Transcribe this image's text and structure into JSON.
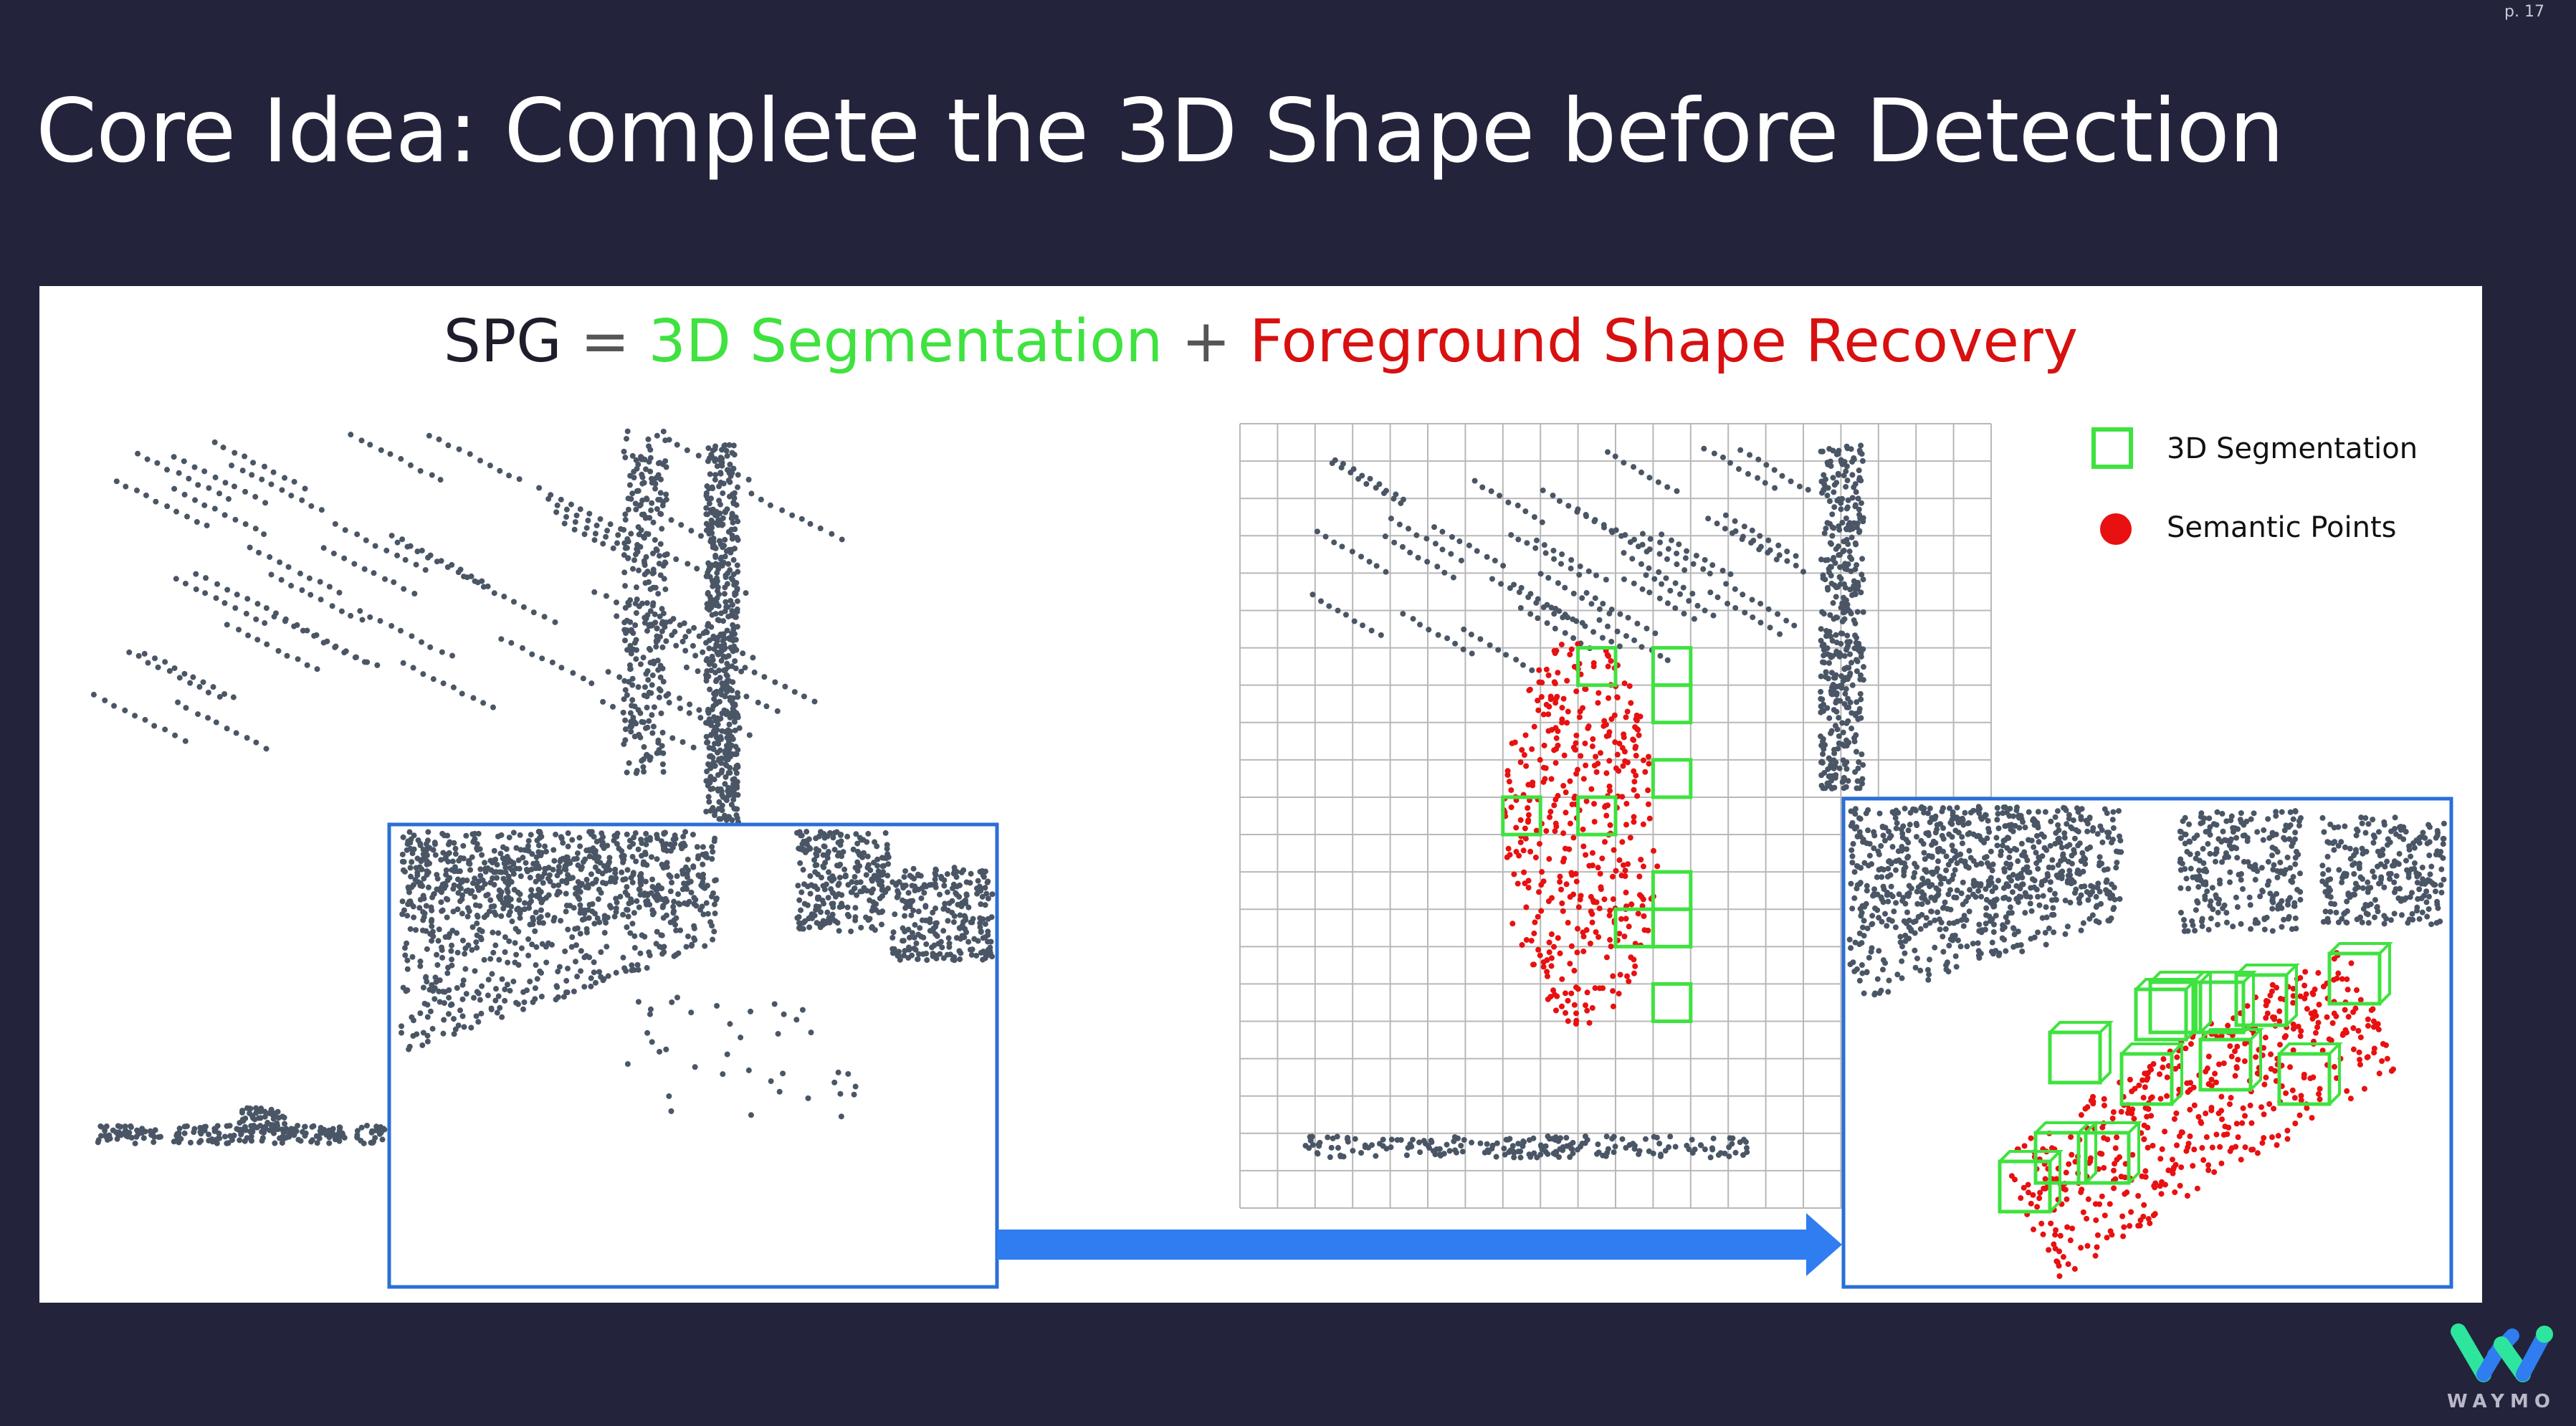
{
  "page_number": "p. 17",
  "title": "Core Idea: Complete the 3D Shape before Detection",
  "subtitle": {
    "spg": "SPG",
    "equals": " = ",
    "segmentation": "3D Segmentation",
    "plus": " + ",
    "recovery": "Foreground Shape Recovery"
  },
  "legend": {
    "items": [
      {
        "label": "3D Segmentation",
        "icon": "green-square-icon",
        "color": "#3fe23f"
      },
      {
        "label": "Semantic Points",
        "icon": "red-dot-icon",
        "color": "#e81010"
      }
    ]
  },
  "colors": {
    "background": "#23233b",
    "point_cloud": "#4a5666",
    "inset_border": "#2a6fd6",
    "arrow": "#2f7df0",
    "segmentation": "#3fe23f",
    "semantic": "#e81010"
  },
  "logo": {
    "text": "WAYMO"
  }
}
